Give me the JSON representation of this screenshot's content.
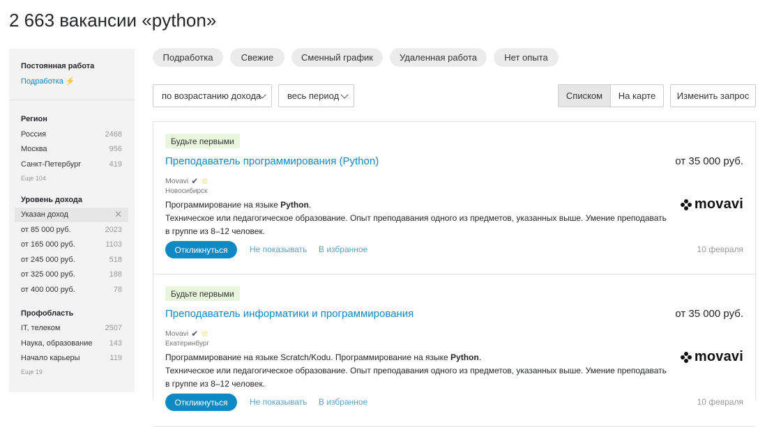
{
  "page_title": "2 663 вакансии «python»",
  "sidebar": {
    "employment": {
      "heading": "Постоянная работа",
      "link": "Подработка",
      "link_icon": "lightning-icon"
    },
    "region": {
      "heading": "Регион",
      "items": [
        {
          "label": "Россия",
          "count": "2468"
        },
        {
          "label": "Москва",
          "count": "956"
        },
        {
          "label": "Санкт-Петербург",
          "count": "419"
        }
      ],
      "more": "Еще 104"
    },
    "income": {
      "heading": "Уровень дохода",
      "active": "Указан доход",
      "items": [
        {
          "label": "от 85 000 руб.",
          "count": "2023"
        },
        {
          "label": "от 165 000 руб.",
          "count": "1103"
        },
        {
          "label": "от 245 000 руб.",
          "count": "518"
        },
        {
          "label": "от 325 000 руб.",
          "count": "188"
        },
        {
          "label": "от 400 000 руб.",
          "count": "78"
        }
      ]
    },
    "profarea": {
      "heading": "Профобласть",
      "items": [
        {
          "label": "IT, телеком",
          "count": "2507"
        },
        {
          "label": "Наука, образование",
          "count": "143"
        },
        {
          "label": "Начало карьеры",
          "count": "119"
        }
      ],
      "more": "Еще 19"
    }
  },
  "chips": [
    "Подработка",
    "Свежие",
    "Сменный график",
    "Удаленная работа",
    "Нет опыта"
  ],
  "controls": {
    "sort": "по возрастанию дохода",
    "period": "весь период",
    "view_list": "Списком",
    "view_map": "На карте",
    "change_query": "Изменить запрос"
  },
  "vacancies": [
    {
      "badge": "Будьте первыми",
      "title": "Преподаватель программирования (Python)",
      "salary": "от 35 000 руб.",
      "company": "Movavi",
      "city": "Новосибирск",
      "desc1_pre": "Программирование на языке ",
      "desc1_bold": "Python",
      "desc1_post": ".",
      "desc2": "Техническое или педагогическое образование. Опыт преподавания одного из предметов, указанных выше. Умение преподавать в группе из 8–12 человек.",
      "logo": "movavi",
      "respond": "Откликнуться",
      "hide": "Не показывать",
      "favorite": "В избранное",
      "date": "10 февраля"
    },
    {
      "badge": "Будьте первыми",
      "title": "Преподаватель информатики и программирования",
      "salary": "от 35 000 руб.",
      "company": "Movavi",
      "city": "Екатеринбург",
      "desc1_pre": "Программирование на языке Scratch/Kodu. Программирование на языке ",
      "desc1_bold": "Python",
      "desc1_post": ".",
      "desc2": "Техническое или педагогическое образование. Опыт преподавания одного из предметов, указанных выше. Умение преподавать в группе из 8–12 человек.",
      "logo": "movavi",
      "respond": "Откликнуться",
      "hide": "Не показывать",
      "favorite": "В избранное",
      "date": "10 февраля"
    }
  ],
  "colors": {
    "link": "#0f89c4",
    "badge_bg": "#e7f6dd",
    "accent_star": "#f2b705"
  }
}
